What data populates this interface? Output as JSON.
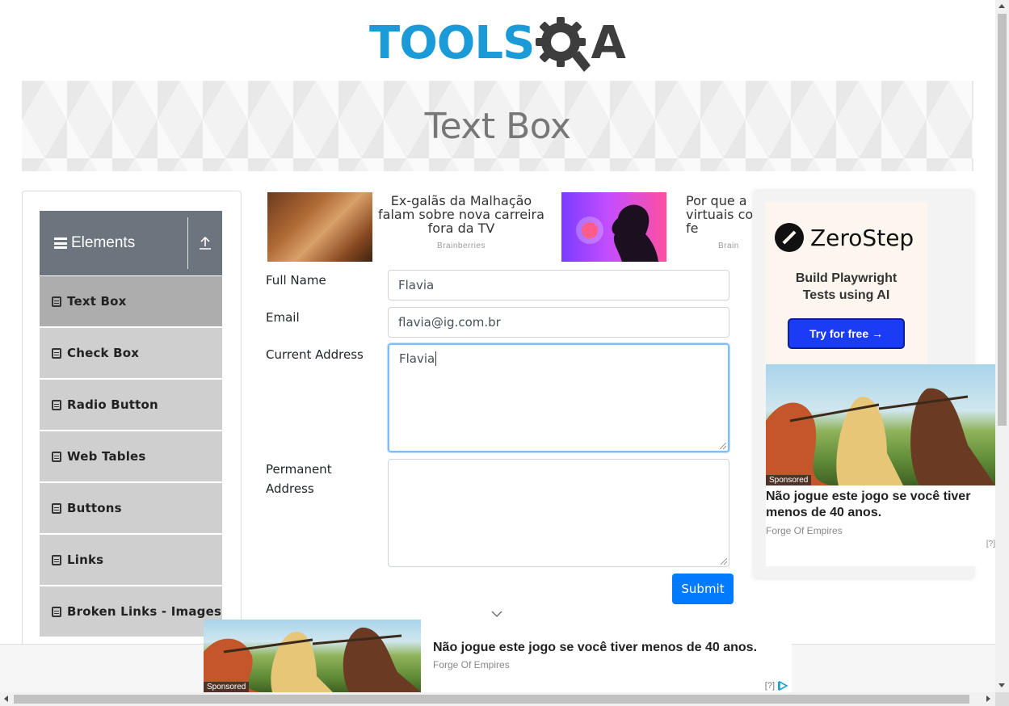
{
  "header": {
    "logo_main": "TOOLS",
    "logo_q": "Q",
    "logo_a": "A"
  },
  "banner": {
    "title": "Text Box"
  },
  "sidebar": {
    "group_title": "Elements",
    "items": [
      {
        "label": "Text Box",
        "active": true
      },
      {
        "label": "Check Box"
      },
      {
        "label": "Radio Button"
      },
      {
        "label": "Web Tables"
      },
      {
        "label": "Buttons"
      },
      {
        "label": "Links"
      },
      {
        "label": "Broken Links - Images"
      }
    ]
  },
  "top_ads": [
    {
      "text": "Ex-galãs da Malhação falam sobre nova carreira fora da TV",
      "source": "Brainberries"
    },
    {
      "text": "Por que a virtuais co vozes fe",
      "source": "Brain"
    }
  ],
  "form": {
    "full_name_label": "Full Name",
    "full_name_value": "Flavia",
    "email_label": "Email",
    "email_value": "flavia@ig.com.br",
    "current_address_label": "Current Address",
    "current_address_value": "Flavia",
    "permanent_address_label_1": "Permanent",
    "permanent_address_label_2": "Address",
    "permanent_address_value": "",
    "submit_label": "Submit"
  },
  "right_ad": {
    "brand": "ZeroStep",
    "tagline_1": "Build Playwright",
    "tagline_2": "Tests using AI",
    "cta": "Try for free →",
    "sponsored": "Sponsored",
    "game_title": "Não jogue este jogo se você tiver menos de 40 anos.",
    "game_source": "Forge Of Empires",
    "adchoice": "[?]"
  },
  "bottom_ad": {
    "sponsored": "Sponsored",
    "title": "Não jogue este jogo se você tiver menos de 40 anos.",
    "source": "Forge Of Empires",
    "adchoice": "[?]"
  },
  "colors": {
    "brand_blue": "#1a9ad6",
    "primary": "#007bff",
    "sidebar_header": "#6c757d",
    "sidebar_item": "#cfcfcf",
    "sidebar_item_active": "#adadad"
  }
}
